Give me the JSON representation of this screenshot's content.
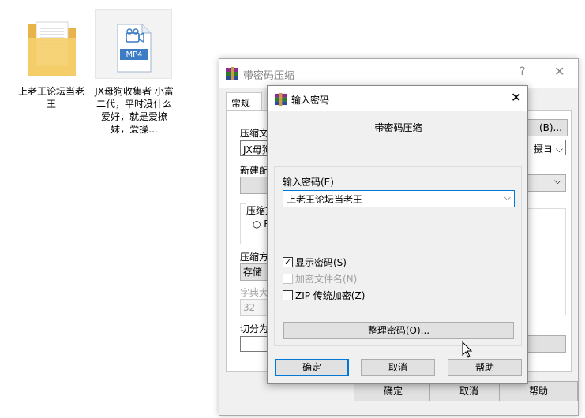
{
  "desktop": {
    "items": [
      {
        "label": "上老王论坛当老王",
        "icon": "folder-icon"
      },
      {
        "label": "JX母狗收集者 小富二代，平时没什么爱好，就是爱撩妹，爱操...",
        "icon": "mp4-file-icon",
        "badge": "MP4"
      }
    ]
  },
  "back_dialog": {
    "title": "带密码压缩",
    "help_symbol": "?",
    "close_symbol": "✕",
    "tab": "常规",
    "labels": {
      "archive_name": "压缩文",
      "archive_value": "JX母狗",
      "browse_btn": "(B)...",
      "update_value": "摄ヨ",
      "new_profile": "新建配",
      "format_group": "压缩文",
      "method": "压缩方",
      "method_value": "存储",
      "dict_label": "字典大",
      "dict_value": "32",
      "split_label": "切分为"
    },
    "buttons": {
      "ok": "确定",
      "cancel": "取消",
      "help": "帮助"
    }
  },
  "front_dialog": {
    "title": "输入密码",
    "close_symbol": "✕",
    "heading": "带密码压缩",
    "password_label": "输入密码(E)",
    "password_value": "上老王论坛当老王",
    "checkboxes": [
      {
        "label": "显示密码(S)",
        "checked": true,
        "enabled": true
      },
      {
        "label": "加密文件名(N)",
        "checked": false,
        "enabled": false
      },
      {
        "label": "ZIP 传统加密(Z)",
        "checked": false,
        "enabled": true
      }
    ],
    "organize_button": "整理密码(O)...",
    "buttons": {
      "ok": "确定",
      "cancel": "取消",
      "help": "帮助"
    }
  },
  "colors": {
    "accent": "#0078d7",
    "dialog_bg": "#f0f0f0",
    "button_bg": "#e1e1e1"
  }
}
